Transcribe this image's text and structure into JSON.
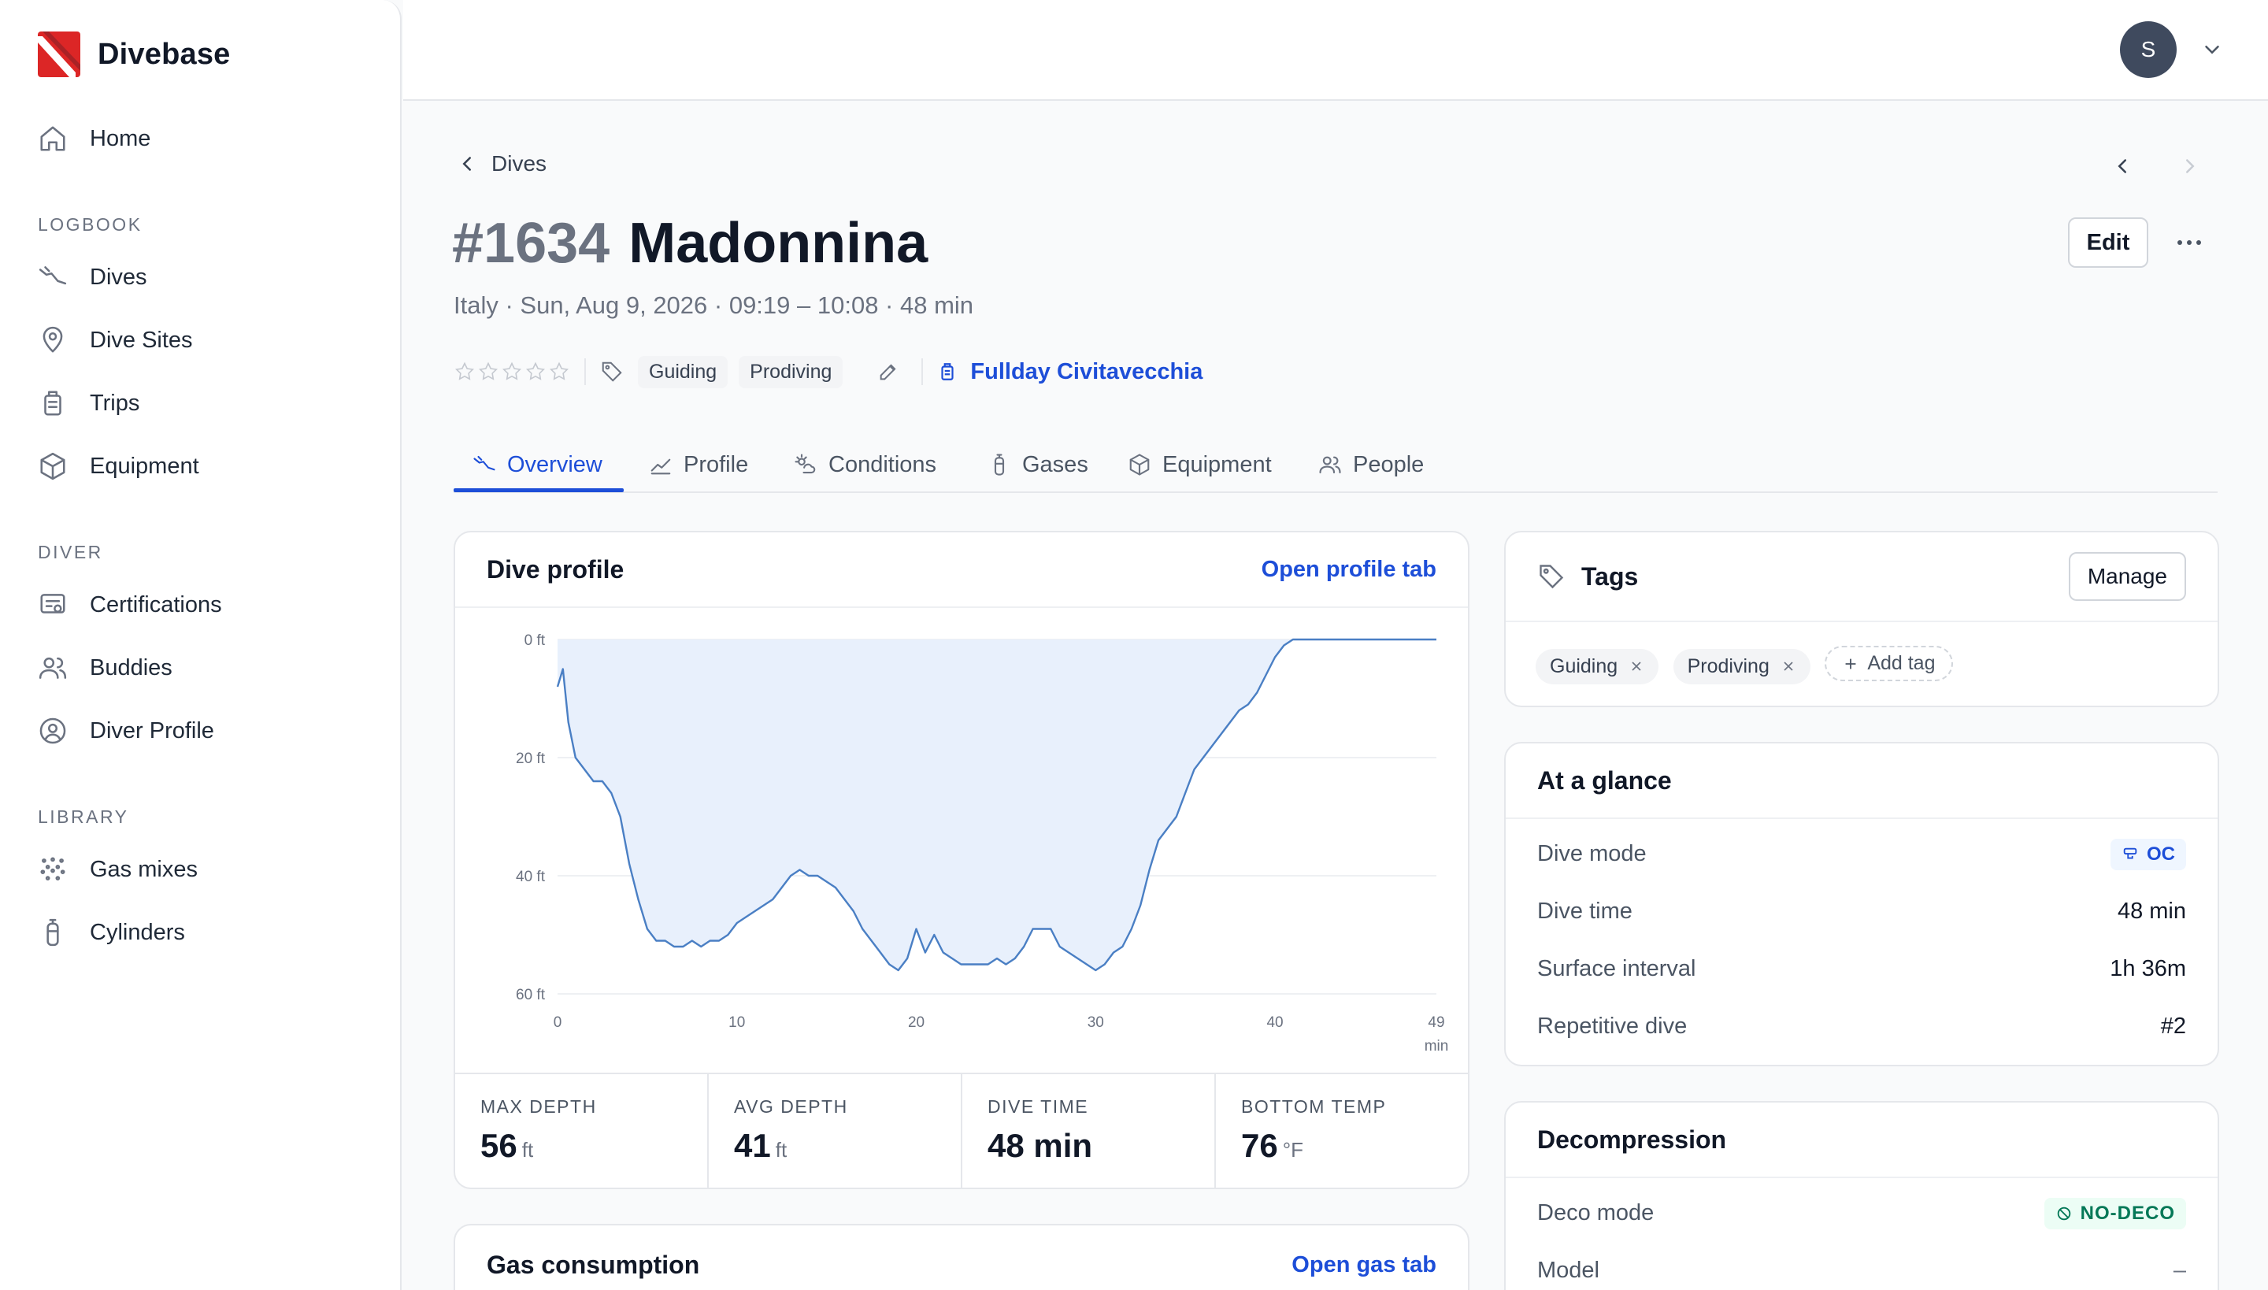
{
  "brand": {
    "name": "Divebase"
  },
  "sidebar": {
    "home": "Home",
    "sections": [
      "LOGBOOK",
      "DIVER",
      "LIBRARY"
    ],
    "logbook": [
      "Dives",
      "Dive Sites",
      "Trips",
      "Equipment"
    ],
    "diver": [
      "Certifications",
      "Buddies",
      "Diver Profile"
    ],
    "library": [
      "Gas mixes",
      "Cylinders"
    ]
  },
  "user": {
    "initial": "S"
  },
  "breadcrumb": {
    "label": "Dives"
  },
  "dive": {
    "number": "#1634",
    "name": "Madonnina",
    "subtitle": "Italy · Sun, Aug 9, 2026 · 09:19 – 10:08 · 48 min",
    "rating": 0,
    "tags": [
      "Guiding",
      "Prodiving"
    ],
    "trip": "Fullday Civitavecchia",
    "edit_label": "Edit"
  },
  "tabs": [
    "Overview",
    "Profile",
    "Conditions",
    "Gases",
    "Equipment",
    "People"
  ],
  "profile_card": {
    "title": "Dive profile",
    "link": "Open profile tab"
  },
  "chart_data": {
    "type": "area",
    "xlabel": "min",
    "ylabel": "",
    "y_unit": "ft",
    "y_inverted": true,
    "xlim": [
      0,
      49
    ],
    "ylim": [
      0,
      60
    ],
    "x_ticks": [
      "0",
      "10",
      "20",
      "30",
      "40",
      "49"
    ],
    "y_ticks": [
      "0 ft",
      "20 ft",
      "40 ft",
      "60 ft"
    ],
    "grid": true,
    "x": [
      0,
      0.3,
      0.6,
      1,
      1.5,
      2,
      2.5,
      3,
      3.5,
      4,
      4.5,
      5,
      5.5,
      6,
      6.5,
      7,
      7.5,
      8,
      8.5,
      9,
      9.5,
      10,
      10.5,
      11,
      11.5,
      12,
      12.5,
      13,
      13.5,
      14,
      14.5,
      15,
      15.5,
      16,
      16.5,
      17,
      17.5,
      18,
      18.5,
      19,
      19.5,
      20,
      20.5,
      21,
      21.5,
      22,
      22.5,
      23,
      23.5,
      24,
      24.5,
      25,
      25.5,
      26,
      26.5,
      27,
      27.5,
      28,
      28.5,
      29,
      29.5,
      30,
      30.5,
      31,
      31.5,
      32,
      32.5,
      33,
      33.5,
      34,
      34.5,
      35,
      35.5,
      36,
      36.5,
      37,
      37.5,
      38,
      38.5,
      39,
      39.5,
      40,
      40.5,
      41,
      41.5,
      42,
      42.5,
      43,
      43.5,
      44,
      44.5,
      45,
      45.5,
      46,
      46.5,
      47,
      47.5,
      48,
      48.3,
      48.6,
      49
    ],
    "y": [
      8,
      5,
      14,
      20,
      22,
      24,
      24,
      26,
      30,
      38,
      44,
      49,
      51,
      51,
      52,
      52,
      51,
      52,
      51,
      51,
      50,
      48,
      47,
      46,
      45,
      44,
      42,
      40,
      39,
      40,
      40,
      41,
      42,
      44,
      46,
      49,
      51,
      53,
      55,
      56,
      54,
      49,
      53,
      50,
      53,
      54,
      55,
      55,
      55,
      55,
      54,
      55,
      54,
      52,
      49,
      49,
      49,
      52,
      53,
      54,
      55,
      56,
      55,
      53,
      52,
      49,
      45,
      39,
      34,
      32,
      30,
      26,
      22,
      20,
      18,
      16,
      14,
      12,
      11,
      9,
      6,
      3,
      1,
      0,
      0,
      0,
      0,
      0,
      0,
      0,
      0,
      0,
      0,
      0,
      0,
      0,
      0,
      0,
      0,
      0,
      0,
      0,
      0,
      0,
      0,
      0
    ],
    "series": [
      {
        "name": "",
        "values": []
      }
    ]
  },
  "stats": [
    {
      "label": "MAX DEPTH",
      "value": "56",
      "unit": "ft"
    },
    {
      "label": "AVG DEPTH",
      "value": "41",
      "unit": "ft"
    },
    {
      "label": "DIVE TIME",
      "value": "48 min",
      "unit": ""
    },
    {
      "label": "BOTTOM TEMP",
      "value": "76",
      "unit": "°F"
    }
  ],
  "gas_card": {
    "title": "Gas consumption",
    "link": "Open gas tab"
  },
  "tags_card": {
    "title": "Tags",
    "manage": "Manage",
    "tags": [
      "Guiding",
      "Prodiving"
    ],
    "add": "Add tag"
  },
  "glance_card": {
    "title": "At a glance",
    "rows": [
      {
        "label": "Dive mode",
        "value": "OC"
      },
      {
        "label": "Dive time",
        "value": "48 min"
      },
      {
        "label": "Surface interval",
        "value": "1h 36m"
      },
      {
        "label": "Repetitive dive",
        "value": "#2"
      }
    ]
  },
  "deco_card": {
    "title": "Decompression",
    "rows": [
      {
        "label": "Deco mode",
        "value": "NO-DECO"
      },
      {
        "label": "Model",
        "value": "–"
      }
    ]
  },
  "colors": {
    "accent": "#1d4ed8",
    "brand_red": "#dc2626",
    "area_fill": "#e8f0fc",
    "line": "#4a7fc4"
  }
}
